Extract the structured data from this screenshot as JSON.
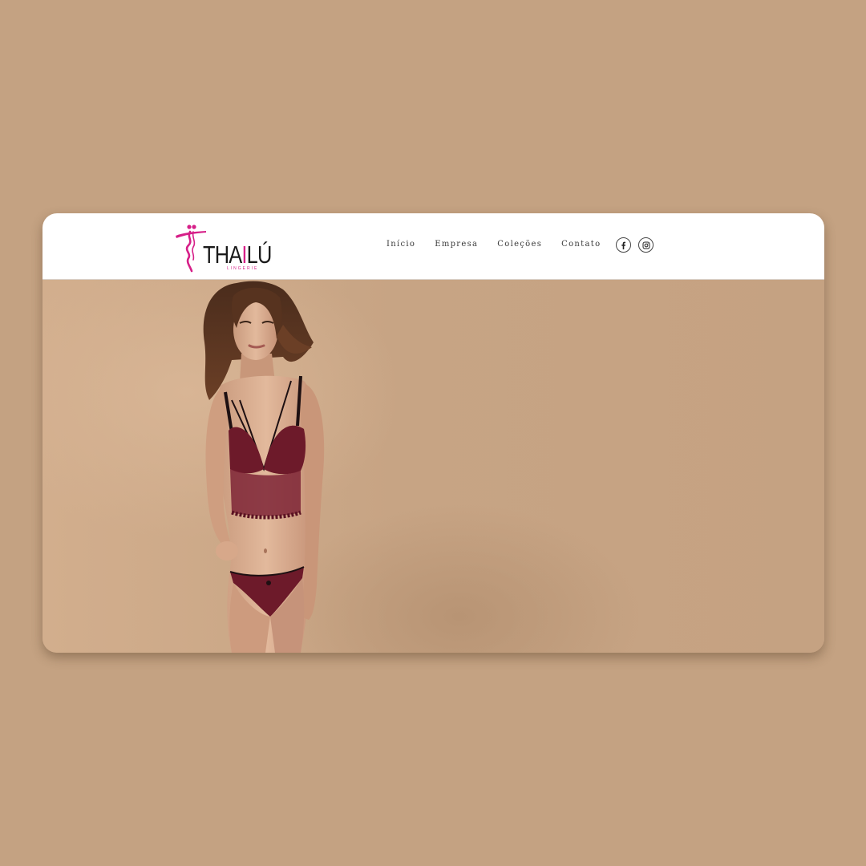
{
  "brand": {
    "name_part1": "THA",
    "name_accent": "I",
    "name_part2": "LÚ",
    "tagline": "LINGERIE",
    "accent_color": "#d61f88"
  },
  "nav": {
    "items": [
      {
        "label": "Início"
      },
      {
        "label": "Empresa"
      },
      {
        "label": "Coleções"
      },
      {
        "label": "Contato"
      }
    ]
  },
  "social": {
    "icons": [
      "facebook-icon",
      "instagram-icon"
    ]
  },
  "hero": {
    "image": "model-in-burgundy-lace-lingerie",
    "background_color": "#c6a383"
  },
  "page": {
    "background_color": "#c4a282"
  }
}
